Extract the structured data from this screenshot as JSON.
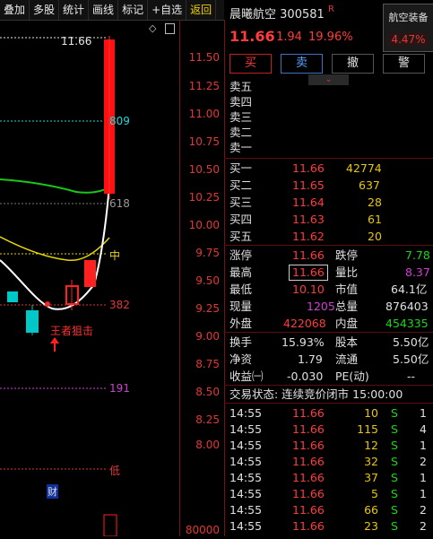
{
  "toolbar": {
    "items": [
      "叠加",
      "多股",
      "统计",
      "画线",
      "标记",
      "+自选",
      "返回"
    ]
  },
  "chart": {
    "price_top_label": "11.66",
    "axis_labels": [
      "11.50",
      "11.25",
      "11.00",
      "10.75",
      "10.50",
      "10.25",
      "10.00",
      "9.75",
      "9.50",
      "9.25",
      "9.00",
      "8.75",
      "8.50",
      "8.25",
      "8.00",
      "80000"
    ],
    "fib_labels": {
      "l809": "809",
      "l618": "618",
      "lmid": "中",
      "l382": "382",
      "l191": "191",
      "llow": "低"
    },
    "annotation": "王者狙击",
    "fin_badge": "财",
    "colors": {
      "up": "#ff2020",
      "down": "#00c8c8",
      "green_ma": "#18c818",
      "yellow_ma": "#e8d800",
      "white_ma": "#ffffff"
    }
  },
  "header": {
    "name": "晨曦航空",
    "code": "300581",
    "flag": "R",
    "sector_name": "航空装备",
    "sector_pct": "4.47%",
    "price": "11.66",
    "change": "1.94",
    "change_pct": "19.96%"
  },
  "trade_buttons": [
    "买",
    "卖",
    "撤",
    "警"
  ],
  "sell_levels": [
    "卖五",
    "卖四",
    "卖三",
    "卖二",
    "卖一"
  ],
  "buy_levels": [
    {
      "label": "买一",
      "price": "11.66",
      "vol": "42774"
    },
    {
      "label": "买二",
      "price": "11.65",
      "vol": "637"
    },
    {
      "label": "买三",
      "price": "11.64",
      "vol": "28"
    },
    {
      "label": "买四",
      "price": "11.63",
      "vol": "61"
    },
    {
      "label": "买五",
      "price": "11.62",
      "vol": "20"
    }
  ],
  "stats": [
    {
      "k1": "涨停",
      "v1": "11.66",
      "k2": "跌停",
      "v2": "7.78"
    },
    {
      "k1": "最高",
      "v1": "11.66",
      "k2": "量比",
      "v2": "8.37"
    },
    {
      "k1": "最低",
      "v1": "10.10",
      "k2": "市值",
      "v2": "64.1亿"
    },
    {
      "k1": "现量",
      "v1": "1205",
      "k2": "总量",
      "v2": "876403"
    },
    {
      "k1": "外盘",
      "v1": "422068",
      "k2": "内盘",
      "v2": "454335"
    }
  ],
  "stats2": [
    {
      "k1": "换手",
      "v1": "15.93%",
      "k2": "股本",
      "v2": "5.50亿"
    },
    {
      "k1": "净资",
      "v1": "1.79",
      "k2": "流通",
      "v2": "5.50亿"
    },
    {
      "k1": "收益㈠",
      "v1": "-0.030",
      "k2": "PE(动)",
      "v2": "--"
    }
  ],
  "trade_status": "交易状态: 连续竞价闭市 15:00:00",
  "ticks": [
    {
      "time": "14:55",
      "price": "11.66",
      "vol": "10",
      "side": "S",
      "n": "1"
    },
    {
      "time": "14:55",
      "price": "11.66",
      "vol": "115",
      "side": "S",
      "n": "4"
    },
    {
      "time": "14:55",
      "price": "11.66",
      "vol": "12",
      "side": "S",
      "n": "1"
    },
    {
      "time": "14:55",
      "price": "11.66",
      "vol": "32",
      "side": "S",
      "n": "2"
    },
    {
      "time": "14:55",
      "price": "11.66",
      "vol": "37",
      "side": "S",
      "n": "1"
    },
    {
      "time": "14:55",
      "price": "11.66",
      "vol": "5",
      "side": "S",
      "n": "1"
    },
    {
      "time": "14:55",
      "price": "11.66",
      "vol": "66",
      "side": "S",
      "n": "2"
    },
    {
      "time": "14:55",
      "price": "11.66",
      "vol": "23",
      "side": "S",
      "n": "2"
    }
  ]
}
